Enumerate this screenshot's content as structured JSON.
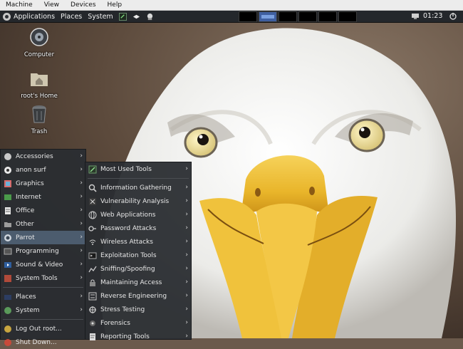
{
  "vm_menubar": {
    "items": [
      "Machine",
      "View",
      "Devices",
      "Help"
    ]
  },
  "top_panel": {
    "menus": [
      "Applications",
      "Places",
      "System"
    ],
    "clock": "01:23"
  },
  "desktop_icons": [
    {
      "label": "Computer",
      "icon": "computer-icon"
    },
    {
      "label": "root's Home",
      "icon": "home-folder-icon"
    },
    {
      "label": "Trash",
      "icon": "trash-icon"
    }
  ],
  "applications_menu": {
    "items": [
      {
        "label": "Accessories",
        "icon": "accessories-icon",
        "submenu": true
      },
      {
        "label": "anon surf",
        "icon": "anonsurf-icon",
        "submenu": true
      },
      {
        "label": "Graphics",
        "icon": "graphics-icon",
        "submenu": true
      },
      {
        "label": "Internet",
        "icon": "internet-icon",
        "submenu": true
      },
      {
        "label": "Office",
        "icon": "office-icon",
        "submenu": true
      },
      {
        "label": "Other",
        "icon": "other-icon",
        "submenu": true
      },
      {
        "label": "Parrot",
        "icon": "parrot-icon",
        "submenu": true,
        "selected": true
      },
      {
        "label": "Programming",
        "icon": "programming-icon",
        "submenu": true
      },
      {
        "label": "Sound & Video",
        "icon": "sound-video-icon",
        "submenu": true
      },
      {
        "label": "System Tools",
        "icon": "system-tools-icon",
        "submenu": true
      }
    ],
    "footer": [
      {
        "label": "Places",
        "icon": "places-icon",
        "submenu": true
      },
      {
        "label": "System",
        "icon": "system-icon",
        "submenu": true
      }
    ],
    "actions": [
      {
        "label": "Log Out root...",
        "icon": "logout-icon"
      },
      {
        "label": "Shut Down...",
        "icon": "shutdown-icon"
      }
    ]
  },
  "parrot_submenu": {
    "items": [
      {
        "label": "Most Used Tools",
        "icon": "most-used-tools-icon"
      },
      {
        "label": "Information Gathering",
        "icon": "information-gathering-icon"
      },
      {
        "label": "Vulnerability Analysis",
        "icon": "vulnerability-analysis-icon"
      },
      {
        "label": "Web Applications",
        "icon": "web-applications-icon"
      },
      {
        "label": "Password Attacks",
        "icon": "password-attacks-icon"
      },
      {
        "label": "Wireless Attacks",
        "icon": "wireless-attacks-icon"
      },
      {
        "label": "Exploitation Tools",
        "icon": "exploitation-tools-icon"
      },
      {
        "label": "Sniffing/Spoofing",
        "icon": "sniffing-spoofing-icon"
      },
      {
        "label": "Maintaining Access",
        "icon": "maintaining-access-icon"
      },
      {
        "label": "Reverse Engineering",
        "icon": "reverse-engineering-icon"
      },
      {
        "label": "Stress Testing",
        "icon": "stress-testing-icon"
      },
      {
        "label": "Forensics",
        "icon": "forensics-icon"
      },
      {
        "label": "Reporting Tools",
        "icon": "reporting-tools-icon"
      }
    ]
  },
  "colors": {
    "panel": "#24272b",
    "menu_bg": "#2a2d31",
    "menu_selected": "#4c5c6e",
    "beak": "#e9b52a"
  }
}
